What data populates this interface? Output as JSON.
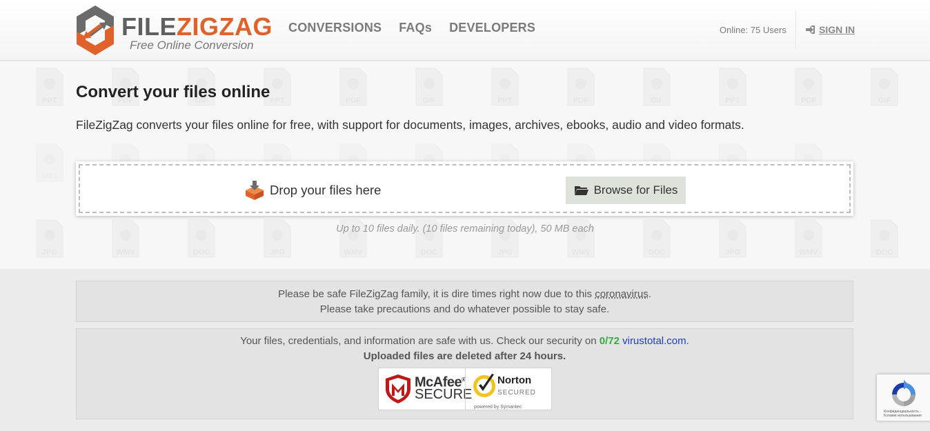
{
  "header": {
    "logo_word_a": "FILE",
    "logo_word_b": "ZIGZAG",
    "logo_tagline": "Free Online Conversion",
    "nav": [
      "CONVERSIONS",
      "FAQs",
      "DEVELOPERS"
    ],
    "online": "Online: 75 Users",
    "signin": "SIGN IN"
  },
  "hero": {
    "title": "Convert your files online",
    "description": "FileZigZag converts your files online for free, with support for documents, images, archives, ebooks, audio and video formats.",
    "drop_label": "Drop your files here",
    "browse_label": "Browse for Files",
    "limits": "Up to 10 files daily. (10 files remaining today), 50 MB each",
    "bg_icon_labels": [
      "PPT",
      "PDF",
      "GIF",
      "MP3",
      "JPG",
      "WMV",
      "DOC"
    ]
  },
  "notice_safety": {
    "line1_prefix": "Please be safe FileZigZag family, it is dire times right now due to this ",
    "line1_link": "coronavirus",
    "line1_suffix": ".",
    "line2": "Please take precautions and do whatever possible to stay safe."
  },
  "notice_security": {
    "line1_prefix": "Your files, credentials, and information are safe with us. Check our security on ",
    "vt_count": "0/72",
    "vt_link": "virustotal.com",
    "line1_suffix": ".",
    "line2": "Uploaded files are deleted after 24 hours.",
    "mcafee_word": "McAfee",
    "mcafee_reg": "®",
    "mcafee_sub": "SECURE",
    "norton_word": "Norton",
    "norton_sub": "SECURED",
    "norton_powered": "powered by Symantec"
  },
  "recaptcha": {
    "text": "Конфиденциальность - Условия использования"
  },
  "colors": {
    "brand_orange": "#e0622b",
    "brand_gray": "#606060",
    "vt_green": "#36a84a",
    "link_blue": "#1f3bc7"
  }
}
